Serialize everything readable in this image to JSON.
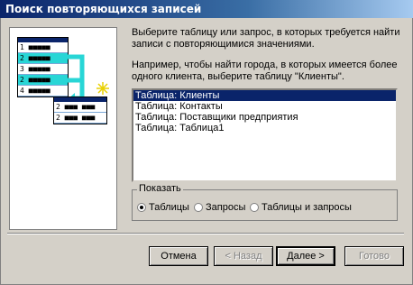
{
  "window": {
    "title": "Поиск повторяющихся записей"
  },
  "illustration": {
    "left_rows": [
      "1 ■■■■■",
      "2 ■■■■■",
      "3 ■■■■■",
      "2 ■■■■■",
      "4 ■■■■■"
    ],
    "right_rows": [
      "2 ■■■ ■■■",
      "2 ■■■ ■■■"
    ]
  },
  "prompt": "Выберите таблицу или запрос, в которых требуется найти записи с повторяющимися значениями.",
  "example": "Например, чтобы найти города, в которых имеется более одного клиента, выберите таблицу \"Клиенты\".",
  "list": {
    "items": [
      "Таблица: Клиенты",
      "Таблица: Контакты",
      "Таблица: Поставщики предприятия",
      "Таблица: Таблица1"
    ],
    "selected_index": 0
  },
  "show_group": {
    "label": "Показать",
    "options": [
      {
        "label": "Таблицы",
        "checked": true
      },
      {
        "label": "Запросы",
        "checked": false
      },
      {
        "label": "Таблицы и запросы",
        "checked": false
      }
    ]
  },
  "buttons": {
    "cancel": "Отмена",
    "back": "< Назад",
    "next": "Далее >",
    "finish": "Готово"
  }
}
